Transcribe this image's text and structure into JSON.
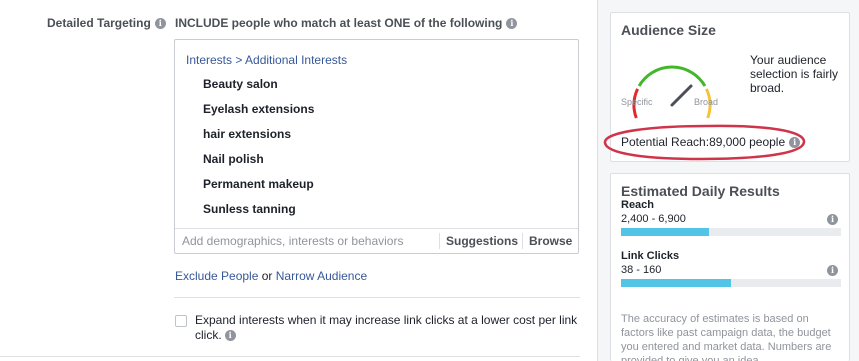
{
  "targeting": {
    "label": "Detailed Targeting",
    "include_text": "INCLUDE people who match at least ONE of the following",
    "breadcrumb": "Interests > Additional Interests",
    "interests": [
      "Beauty salon",
      "Eyelash extensions",
      "hair extensions",
      "Nail polish",
      "Permanent makeup",
      "Sunless tanning"
    ],
    "add_placeholder": "Add demographics, interests or behaviors",
    "suggestions_label": "Suggestions",
    "browse_label": "Browse",
    "exclude_people_label": "Exclude People",
    "or_text": "or",
    "narrow_audience_label": "Narrow Audience",
    "expand_label": "Expand interests when it may increase link clicks at a lower cost per link click.",
    "expand_checked": false
  },
  "audience_size": {
    "title": "Audience Size",
    "specific_label": "Specific",
    "broad_label": "Broad",
    "description": "Your audience selection is fairly broad.",
    "potential_reach_label": "Potential Reach:",
    "potential_reach_value": "89,000 people",
    "highlight_color": "#d0344a"
  },
  "estimated_results": {
    "title": "Estimated Daily Results",
    "metrics": [
      {
        "name": "Reach",
        "range": "2,400 - 6,900",
        "bar_fraction": 0.4
      },
      {
        "name": "Link Clicks",
        "range": "38 - 160",
        "bar_fraction": 0.5
      }
    ],
    "disclaimer": "The accuracy of estimates is based on factors like past campaign data, the budget you entered and market data. Numbers are provided to give you an idea"
  },
  "colors": {
    "link": "#365899",
    "bar": "#52c4e6",
    "gauge_red": "#e02c2c",
    "gauge_yellow": "#f5c33b",
    "gauge_green": "#42b72a"
  }
}
